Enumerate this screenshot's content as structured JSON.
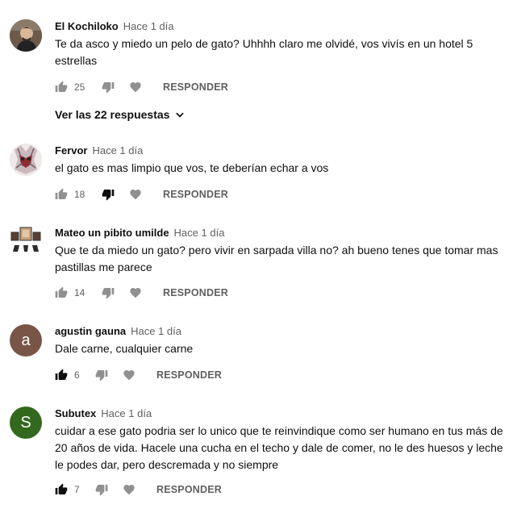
{
  "comments": [
    {
      "author": "El Kochiloko",
      "time": "Hace 1 día",
      "text": "Te da asco y miedo un pelo de gato? Uhhhh claro me olvidé, vos vivís en un hotel 5 estrellas",
      "likes": "25",
      "reply": "RESPONDER",
      "avatar_icon": "profile-photo"
    },
    {
      "author": "Fervor",
      "time": "Hace 1 día",
      "text": "el gato es mas limpio que vos, te deberían echar a vos",
      "likes": "18",
      "reply": "RESPONDER",
      "avatar_icon": "profile-photo"
    },
    {
      "author": "Mateo un pibito umilde",
      "time": "Hace 1 día",
      "text": "Que te da miedo un gato? pero vivir en sarpada villa no? ah bueno tenes que tomar mas pastillas me parece",
      "likes": "14",
      "reply": "RESPONDER",
      "avatar_icon": "profile-photo"
    },
    {
      "author": "agustin gauna",
      "time": "Hace 1 día",
      "text": "Dale carne, cualquier carne",
      "likes": "6",
      "reply": "RESPONDER",
      "avatar_letter": "a",
      "avatar_color": "#795548"
    },
    {
      "author": "Subutex",
      "time": "Hace 1 día",
      "text": "cuidar a ese gato podria ser lo unico que te reinvindique como ser humano en tus más de 20 años de vida. Hacele una cucha en el techo y dale de comer, no le des huesos y leche le podes dar, pero descremada y no siempre",
      "likes": "7",
      "reply": "RESPONDER",
      "avatar_letter": "S",
      "avatar_color": "#33691e"
    }
  ],
  "view_replies": {
    "label": "Ver las 22 respuestas",
    "icon": "chevron-down-icon"
  },
  "colors": {
    "text_primary": "#0f0f0f",
    "text_secondary": "#606060",
    "icon_light": "#909090",
    "icon_dark": "#0f0f0f"
  }
}
